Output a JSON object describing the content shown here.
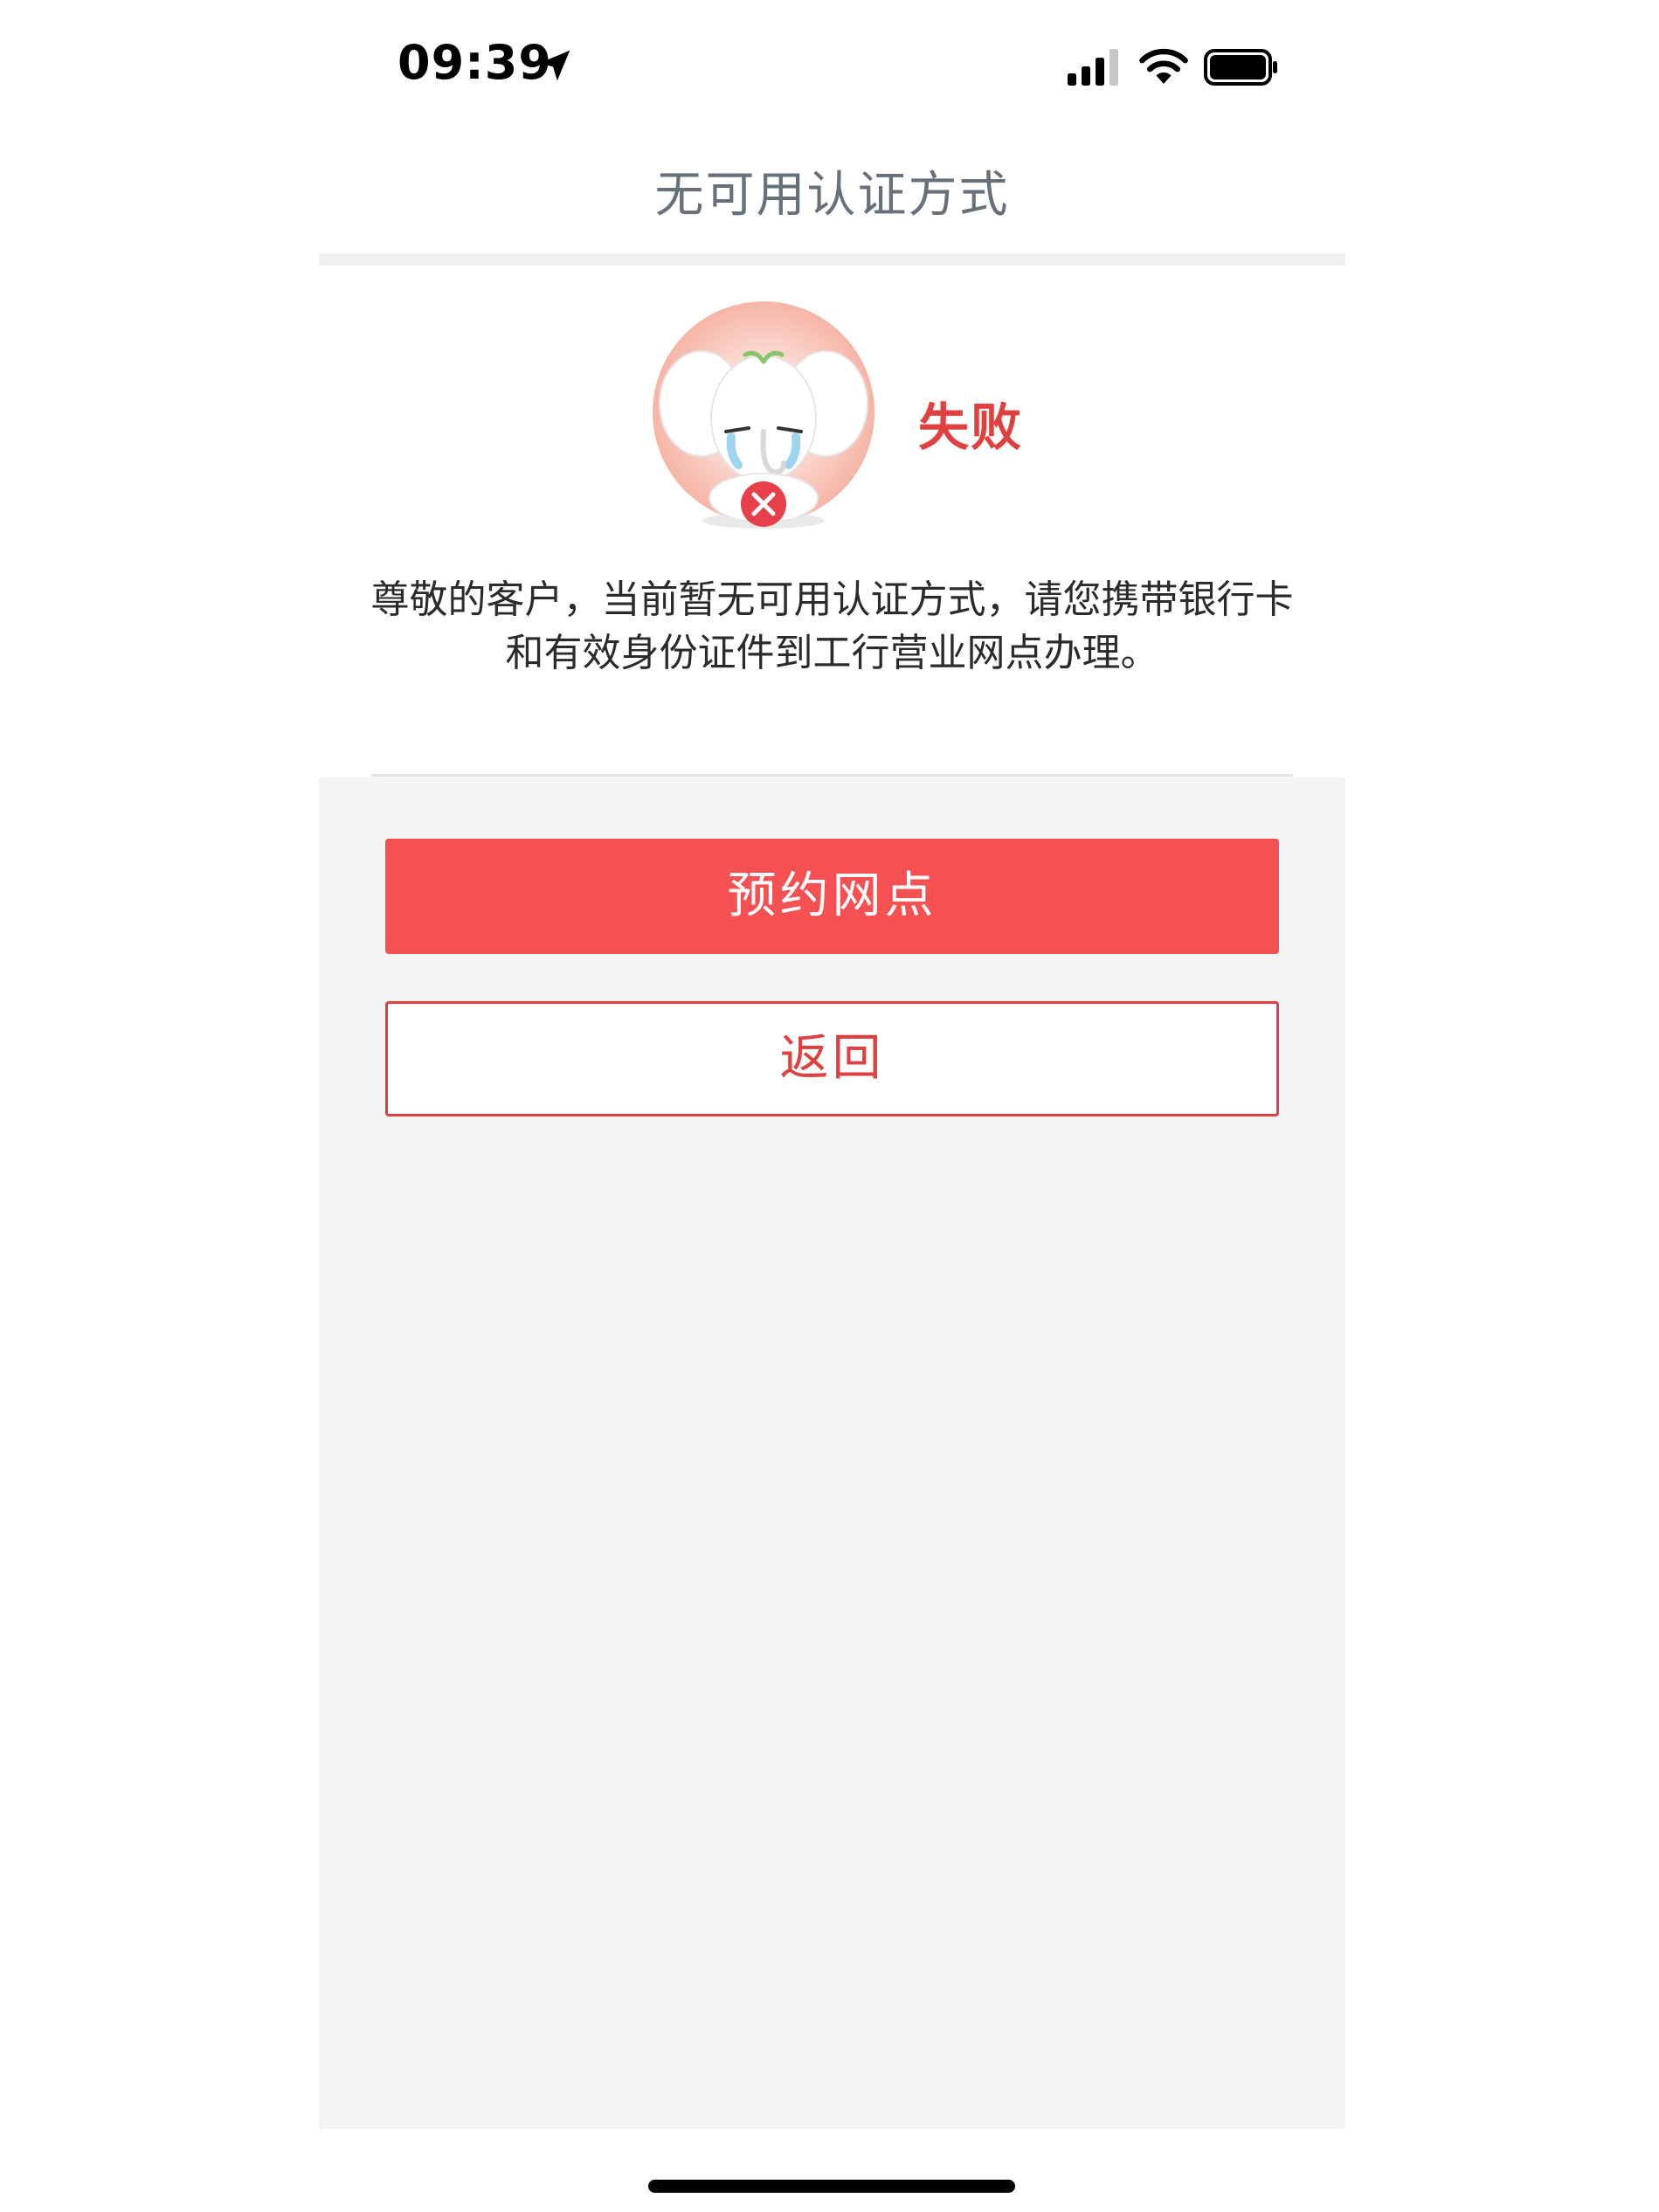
{
  "status_bar": {
    "time": "09:39",
    "icons": [
      "location-arrow-icon",
      "signal-icon",
      "wifi-icon",
      "battery-icon"
    ]
  },
  "nav": {
    "title": "无可用认证方式"
  },
  "result": {
    "status": "失败",
    "message": "尊敬的客户，当前暂无可用认证方式，请您携带银行卡和有效身份证件到工行营业网点办理。",
    "mascot": "crying-elephant-failure-icon"
  },
  "actions": {
    "primary_label": "预约网点",
    "secondary_label": "返回"
  },
  "colors": {
    "accent": "#e0403f",
    "primary_button": "#f55052",
    "background": "#f4f4f4",
    "title_text": "#66717c"
  }
}
